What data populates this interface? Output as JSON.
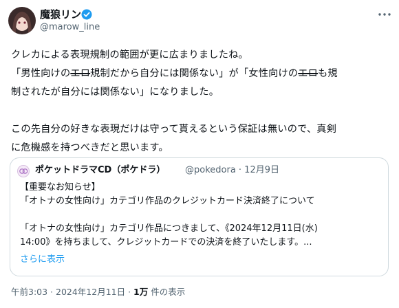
{
  "author": {
    "display_name": "魔狼リン",
    "handle": "@marow_line",
    "verified": true
  },
  "tweet": {
    "line1": "クレカによる表現規制の範囲が更に広まりましたね。",
    "line2_a": "「男性向けの",
    "line2_strike": "エロ",
    "line2_b": "規制だから自分には関係ない」が「女性向けの",
    "line2_strike2": "エロ",
    "line2_c": "も規",
    "line3": "制されたが自分には関係ない」になりました。",
    "line5": "この先自分の好きな表現だけは守って貰えるという保証は無いので、真剣",
    "line6": "に危機感を持つべきだと思います。"
  },
  "quote": {
    "display_name": "ポケットドラマCD（ポケドラ）",
    "handle_date": "@pokedora · 12月9日",
    "line1": "【重要なお知らせ】",
    "line2": "「オトナの女性向け」カテゴリ作品のクレジットカード決済終了について",
    "line3": "「オトナの女性向け」カテゴリ作品につきまして、《2024年12月11日(水)",
    "line4": "14:00》を持ちまして、クレジットカードでの決済を終了いたします。...",
    "show_more": "さらに表示"
  },
  "meta": {
    "time_date": "午前3:03 · 2024年12月11日 · ",
    "views_count": "1万",
    "views_label": " 件の表示"
  },
  "colors": {
    "accent": "#1d9bf0",
    "secondary_text": "#536471",
    "border": "#cfd9de"
  }
}
